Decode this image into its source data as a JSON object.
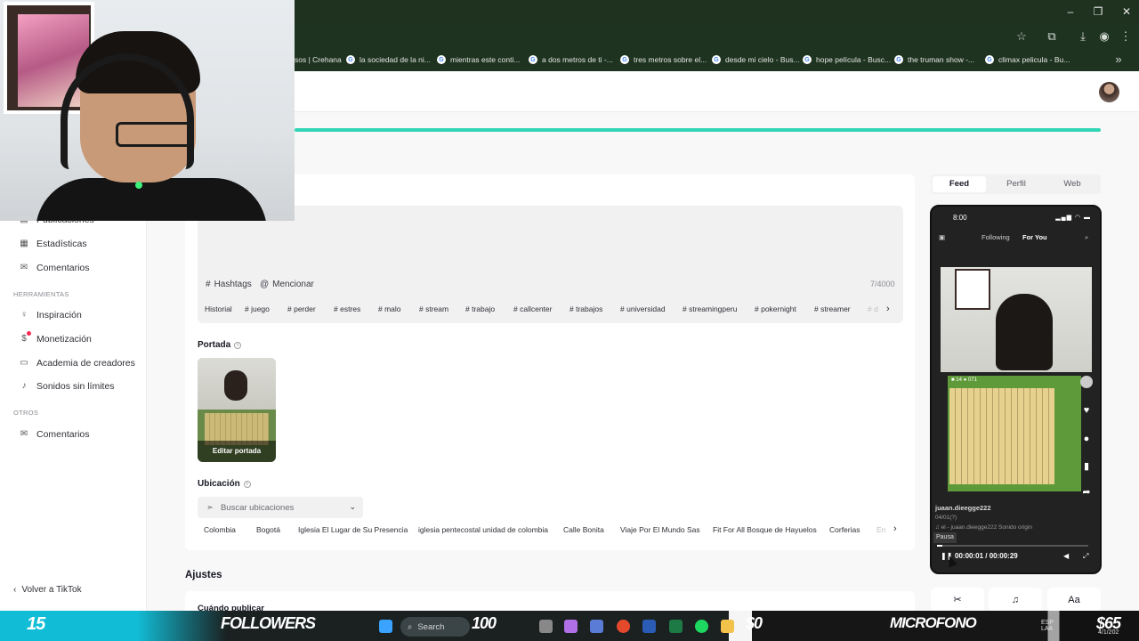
{
  "browser": {
    "bookmarks": [
      {
        "label": "sos | Crehana",
        "favicon": "none"
      },
      {
        "label": "la sociedad de la ni...",
        "favicon": "google-icon"
      },
      {
        "label": "mientras este conti...",
        "favicon": "google-icon"
      },
      {
        "label": "a dos metros de ti -...",
        "favicon": "google-icon"
      },
      {
        "label": "tres metros sobre el...",
        "favicon": "google-icon"
      },
      {
        "label": "desde mi cielo - Bus...",
        "favicon": "google-icon"
      },
      {
        "label": "hope película - Busc...",
        "favicon": "google-icon"
      },
      {
        "label": "the truman show -...",
        "favicon": "google-icon"
      },
      {
        "label": "climax pelicula - Bu...",
        "favicon": "google-icon"
      }
    ],
    "window_controls": [
      "–",
      "❐",
      "✕"
    ]
  },
  "sidebar": {
    "items_top": [
      {
        "label": "Publicaciones",
        "icon": "posts-icon"
      },
      {
        "label": "Estadísticas",
        "icon": "analytics-icon"
      },
      {
        "label": "Comentarios",
        "icon": "comments-icon"
      }
    ],
    "section_tools": "HERRAMIENTAS",
    "items_tools": [
      {
        "label": "Inspiración",
        "icon": "bulb-icon"
      },
      {
        "label": "Monetización",
        "icon": "dollar-icon"
      },
      {
        "label": "Academia de creadores",
        "icon": "book-icon"
      },
      {
        "label": "Sonidos sin límites",
        "icon": "music-icon"
      }
    ],
    "section_other": "OTROS",
    "items_other": [
      {
        "label": "Comentarios",
        "icon": "comments-icon"
      }
    ],
    "back": "Volver a TikTok"
  },
  "editor": {
    "hashtags_btn": "Hashtags",
    "mention_btn": "Mencionar",
    "char_count": "7/4000",
    "history_label": "Historial",
    "hashtag_chips": [
      "# juego",
      "# perder",
      "# estres",
      "# malo",
      "# stream",
      "# trabajo",
      "# callcenter",
      "# trabajos",
      "# universidad",
      "# streamingperu",
      "# pokernight",
      "# streamer",
      "# d"
    ],
    "cover_label": "Portada",
    "edit_cover": "Editar portada",
    "location_label": "Ubicación",
    "location_placeholder": "Buscar ubicaciones",
    "location_chips": [
      "Colombia",
      "Bogotá",
      "Iglesia El Lugar de Su Presencia",
      "iglesia pentecostal unidad de colombia",
      "Calle Bonita",
      "Viaje Por El Mundo Sas",
      "Fit For All Bosque de Hayuelos",
      "Corferias",
      "En"
    ],
    "settings_title": "Ajustes",
    "when_publish": "Cuándo publicar"
  },
  "preview": {
    "tabs": [
      "Feed",
      "Perfil",
      "Web"
    ],
    "active_tab": "Feed",
    "phone_time": "8:00",
    "nav_following": "Following",
    "nav_foryou": "For You",
    "username": "juaan.dieegge222",
    "date": "04/01(?)",
    "sound_line": "♫ el - juaan.dieegge222   Sonido origin",
    "pause_tooltip": "Pausa",
    "time_display": "00:00:01 / 00:00:29",
    "game_counter": "14",
    "game_timer": "071"
  },
  "tools": [
    "✂",
    "♫",
    "Aa"
  ],
  "taskbar": {
    "followers_count": "15",
    "followers_label": "FOLLOWERS",
    "search": "Search",
    "hundred": "100",
    "money_left": "$0",
    "mic_label": "MICROFONO",
    "money_right": "$65",
    "lang": "ESP",
    "lang2": "LAA",
    "date": "4/1/202"
  },
  "colors": {
    "accent_teal": "#30d5b5",
    "tiktok_red": "#fe2c55",
    "chrome_green": "#1f3321"
  }
}
